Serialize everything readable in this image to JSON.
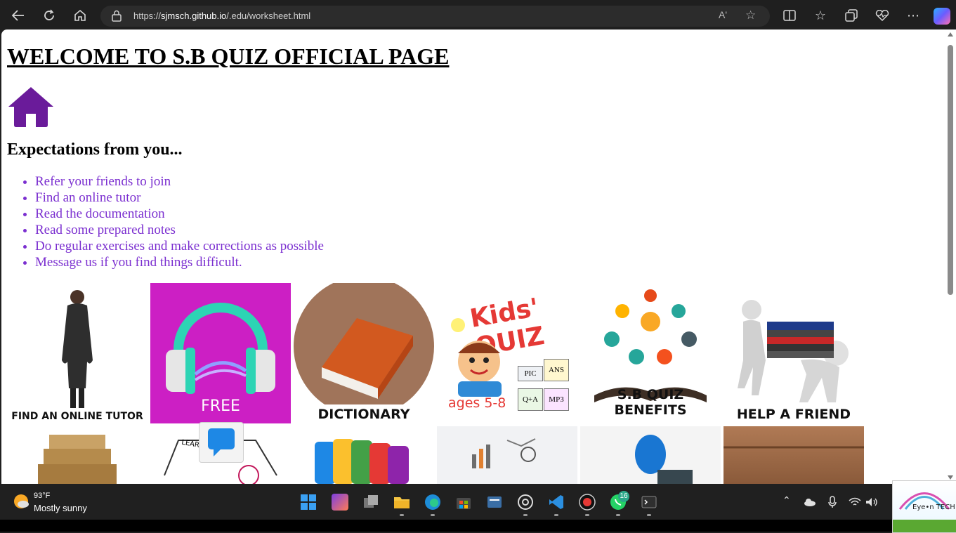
{
  "browser": {
    "url_prefix": "https://",
    "url_host": "sjmsch.github.io",
    "url_path": "/.edu/worksheet.html",
    "read_aloud_label": "Aʹ"
  },
  "page": {
    "title": "WELCOME TO S.B QUIZ OFFICIAL PAGE",
    "subtitle": "Expectations from you...",
    "expectations": [
      "Refer your friends to join",
      "Find an online tutor",
      "Read the documentation",
      "Read some prepared notes",
      "Do regular exercises and make corrections as possible",
      "Message us if you find things difficult."
    ],
    "tiles": [
      {
        "caption": "FIND AN ONLINE TUTOR"
      },
      {
        "caption": "FREE"
      },
      {
        "caption": "DICTIONARY"
      },
      {
        "caption": "Kids' QUIZ",
        "sub": "ages 5-8",
        "badges": [
          "PIC",
          "ANS",
          "Q+A",
          "MP3"
        ]
      },
      {
        "caption": "S.B QUIZ BENEFITS"
      },
      {
        "caption": "HELP A FRIEND"
      }
    ],
    "second_row_partial_text": "LEARNING",
    "colors": {
      "list": "#7b2fd0",
      "home_icon": "#6a1b9a",
      "free_bg": "#cc1fc4"
    }
  },
  "taskbar": {
    "temperature": "93°F",
    "condition": "Mostly sunny",
    "whatsapp_badge": "16",
    "logo_text": "Eye•n TECH"
  }
}
